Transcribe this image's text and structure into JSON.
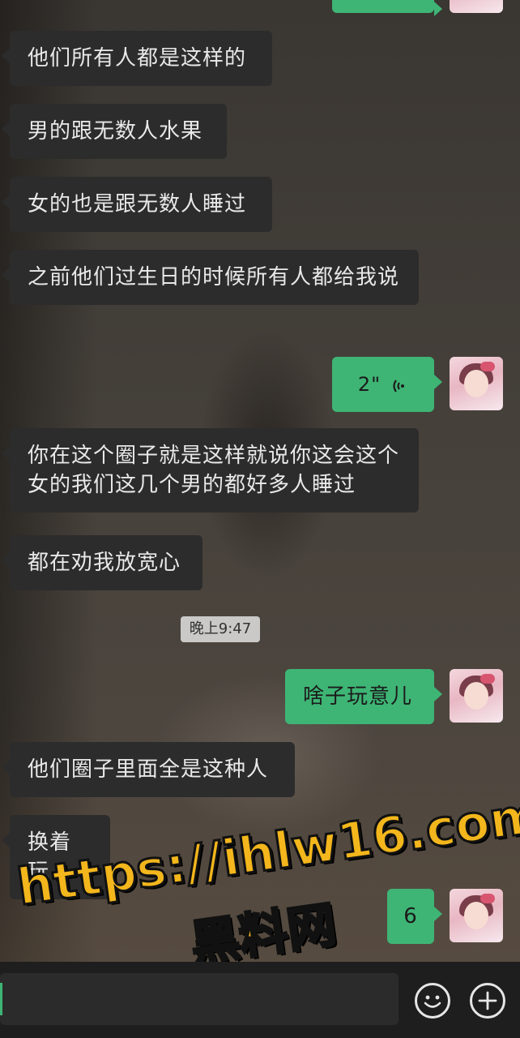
{
  "messages": [
    {
      "text": "他们所有人都是这样的"
    },
    {
      "text": "男的跟无数人水果"
    },
    {
      "text": "女的也是跟无数人睡过"
    },
    {
      "text": "之前他们过生日的时候所有人都给我说"
    },
    {
      "text": "你在这个圈子就是这样就说你这会这个女的我们这几个男的都好多人睡过"
    },
    {
      "text": "都在劝我放宽心"
    },
    {
      "text": "他们圈子里面全是这种人"
    },
    {
      "text": "换着玩"
    }
  ],
  "outgoing": {
    "voice_duration": "2\"",
    "reply_1": "啥子玩意儿",
    "reply_2": "6"
  },
  "timestamp": "晚上9:47",
  "watermark": {
    "url": "https://ihlw16.com",
    "site": "黑料网"
  },
  "icons": {
    "voice": "voice-wave-icon",
    "emoji": "emoji-icon",
    "plus": "plus-icon"
  },
  "colors": {
    "outgoing_bubble": "#3eb575",
    "incoming_bubble": "#2c2c2c",
    "watermark": "#f3b61c"
  }
}
